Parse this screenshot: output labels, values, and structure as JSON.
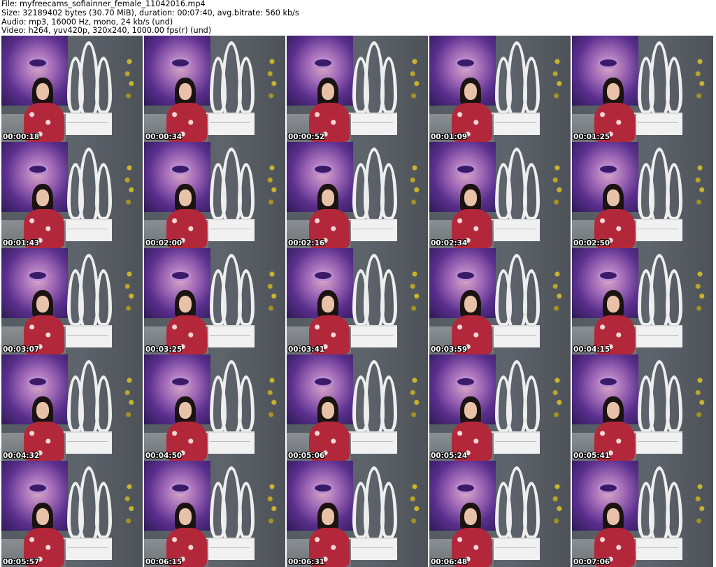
{
  "header": {
    "file_line": "File: myfreecams_sofiainner_female_11042016.mp4",
    "size_line": "Size: 32189402 bytes (30.70 MiB), duration: 00:07:40, avg.bitrate: 560 kb/s",
    "audio_line": "Audio: mp3, 16000 Hz, mono, 24 kb/s (und)",
    "video_line": "Video: h264, yuv420p, 320x240, 1000.00 fps(r) (und)"
  },
  "thumbnails": [
    {
      "timestamp": "00:00:18"
    },
    {
      "timestamp": "00:00:34"
    },
    {
      "timestamp": "00:00:52"
    },
    {
      "timestamp": "00:01:09"
    },
    {
      "timestamp": "00:01:25"
    },
    {
      "timestamp": "00:01:43"
    },
    {
      "timestamp": "00:02:00"
    },
    {
      "timestamp": "00:02:16"
    },
    {
      "timestamp": "00:02:34"
    },
    {
      "timestamp": "00:02:50"
    },
    {
      "timestamp": "00:03:07"
    },
    {
      "timestamp": "00:03:25"
    },
    {
      "timestamp": "00:03:41"
    },
    {
      "timestamp": "00:03:59"
    },
    {
      "timestamp": "00:04:15"
    },
    {
      "timestamp": "00:04:32"
    },
    {
      "timestamp": "00:04:50"
    },
    {
      "timestamp": "00:05:06"
    },
    {
      "timestamp": "00:05:24"
    },
    {
      "timestamp": "00:05:41"
    },
    {
      "timestamp": "00:05:57"
    },
    {
      "timestamp": "00:06:15"
    },
    {
      "timestamp": "00:06:31"
    },
    {
      "timestamp": "00:06:48"
    },
    {
      "timestamp": "00:07:06"
    }
  ]
}
